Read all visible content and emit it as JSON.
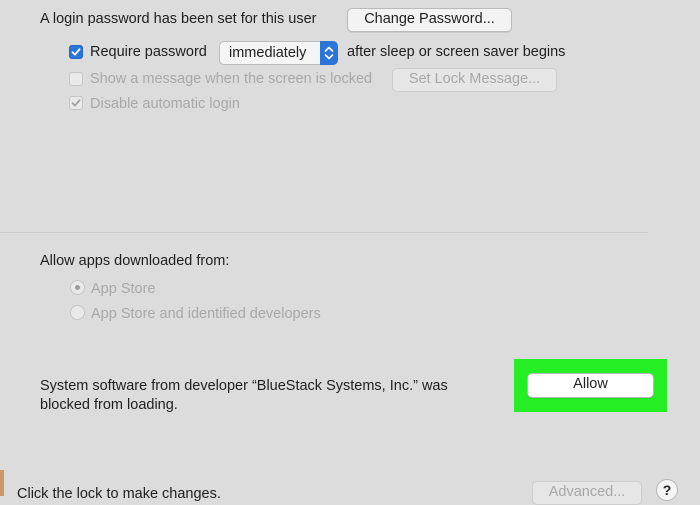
{
  "password": {
    "status_text": "A login password has been set for this user",
    "change_button": "Change Password..."
  },
  "require_password": {
    "checked": true,
    "label": "Require password",
    "select_value": "immediately",
    "suffix": "after sleep or screen saver begins"
  },
  "lock_message": {
    "checked": false,
    "label": "Show a message when the screen is locked",
    "button": "Set Lock Message..."
  },
  "auto_login": {
    "checked": true,
    "label": "Disable automatic login"
  },
  "downloads": {
    "heading": "Allow apps downloaded from:",
    "options": [
      {
        "label": "App Store",
        "selected": true
      },
      {
        "label": "App Store and identified developers",
        "selected": false
      }
    ]
  },
  "blocked": {
    "line1": "System software from developer “BlueStack Systems, Inc.” was",
    "line2": "blocked from loading.",
    "allow_button": "Allow"
  },
  "footer": {
    "lock_text": "Click the lock to make changes.",
    "advanced_button": "Advanced...",
    "help_label": "?"
  },
  "colors": {
    "accent": "#2c74d8",
    "highlight": "#25ee25"
  }
}
